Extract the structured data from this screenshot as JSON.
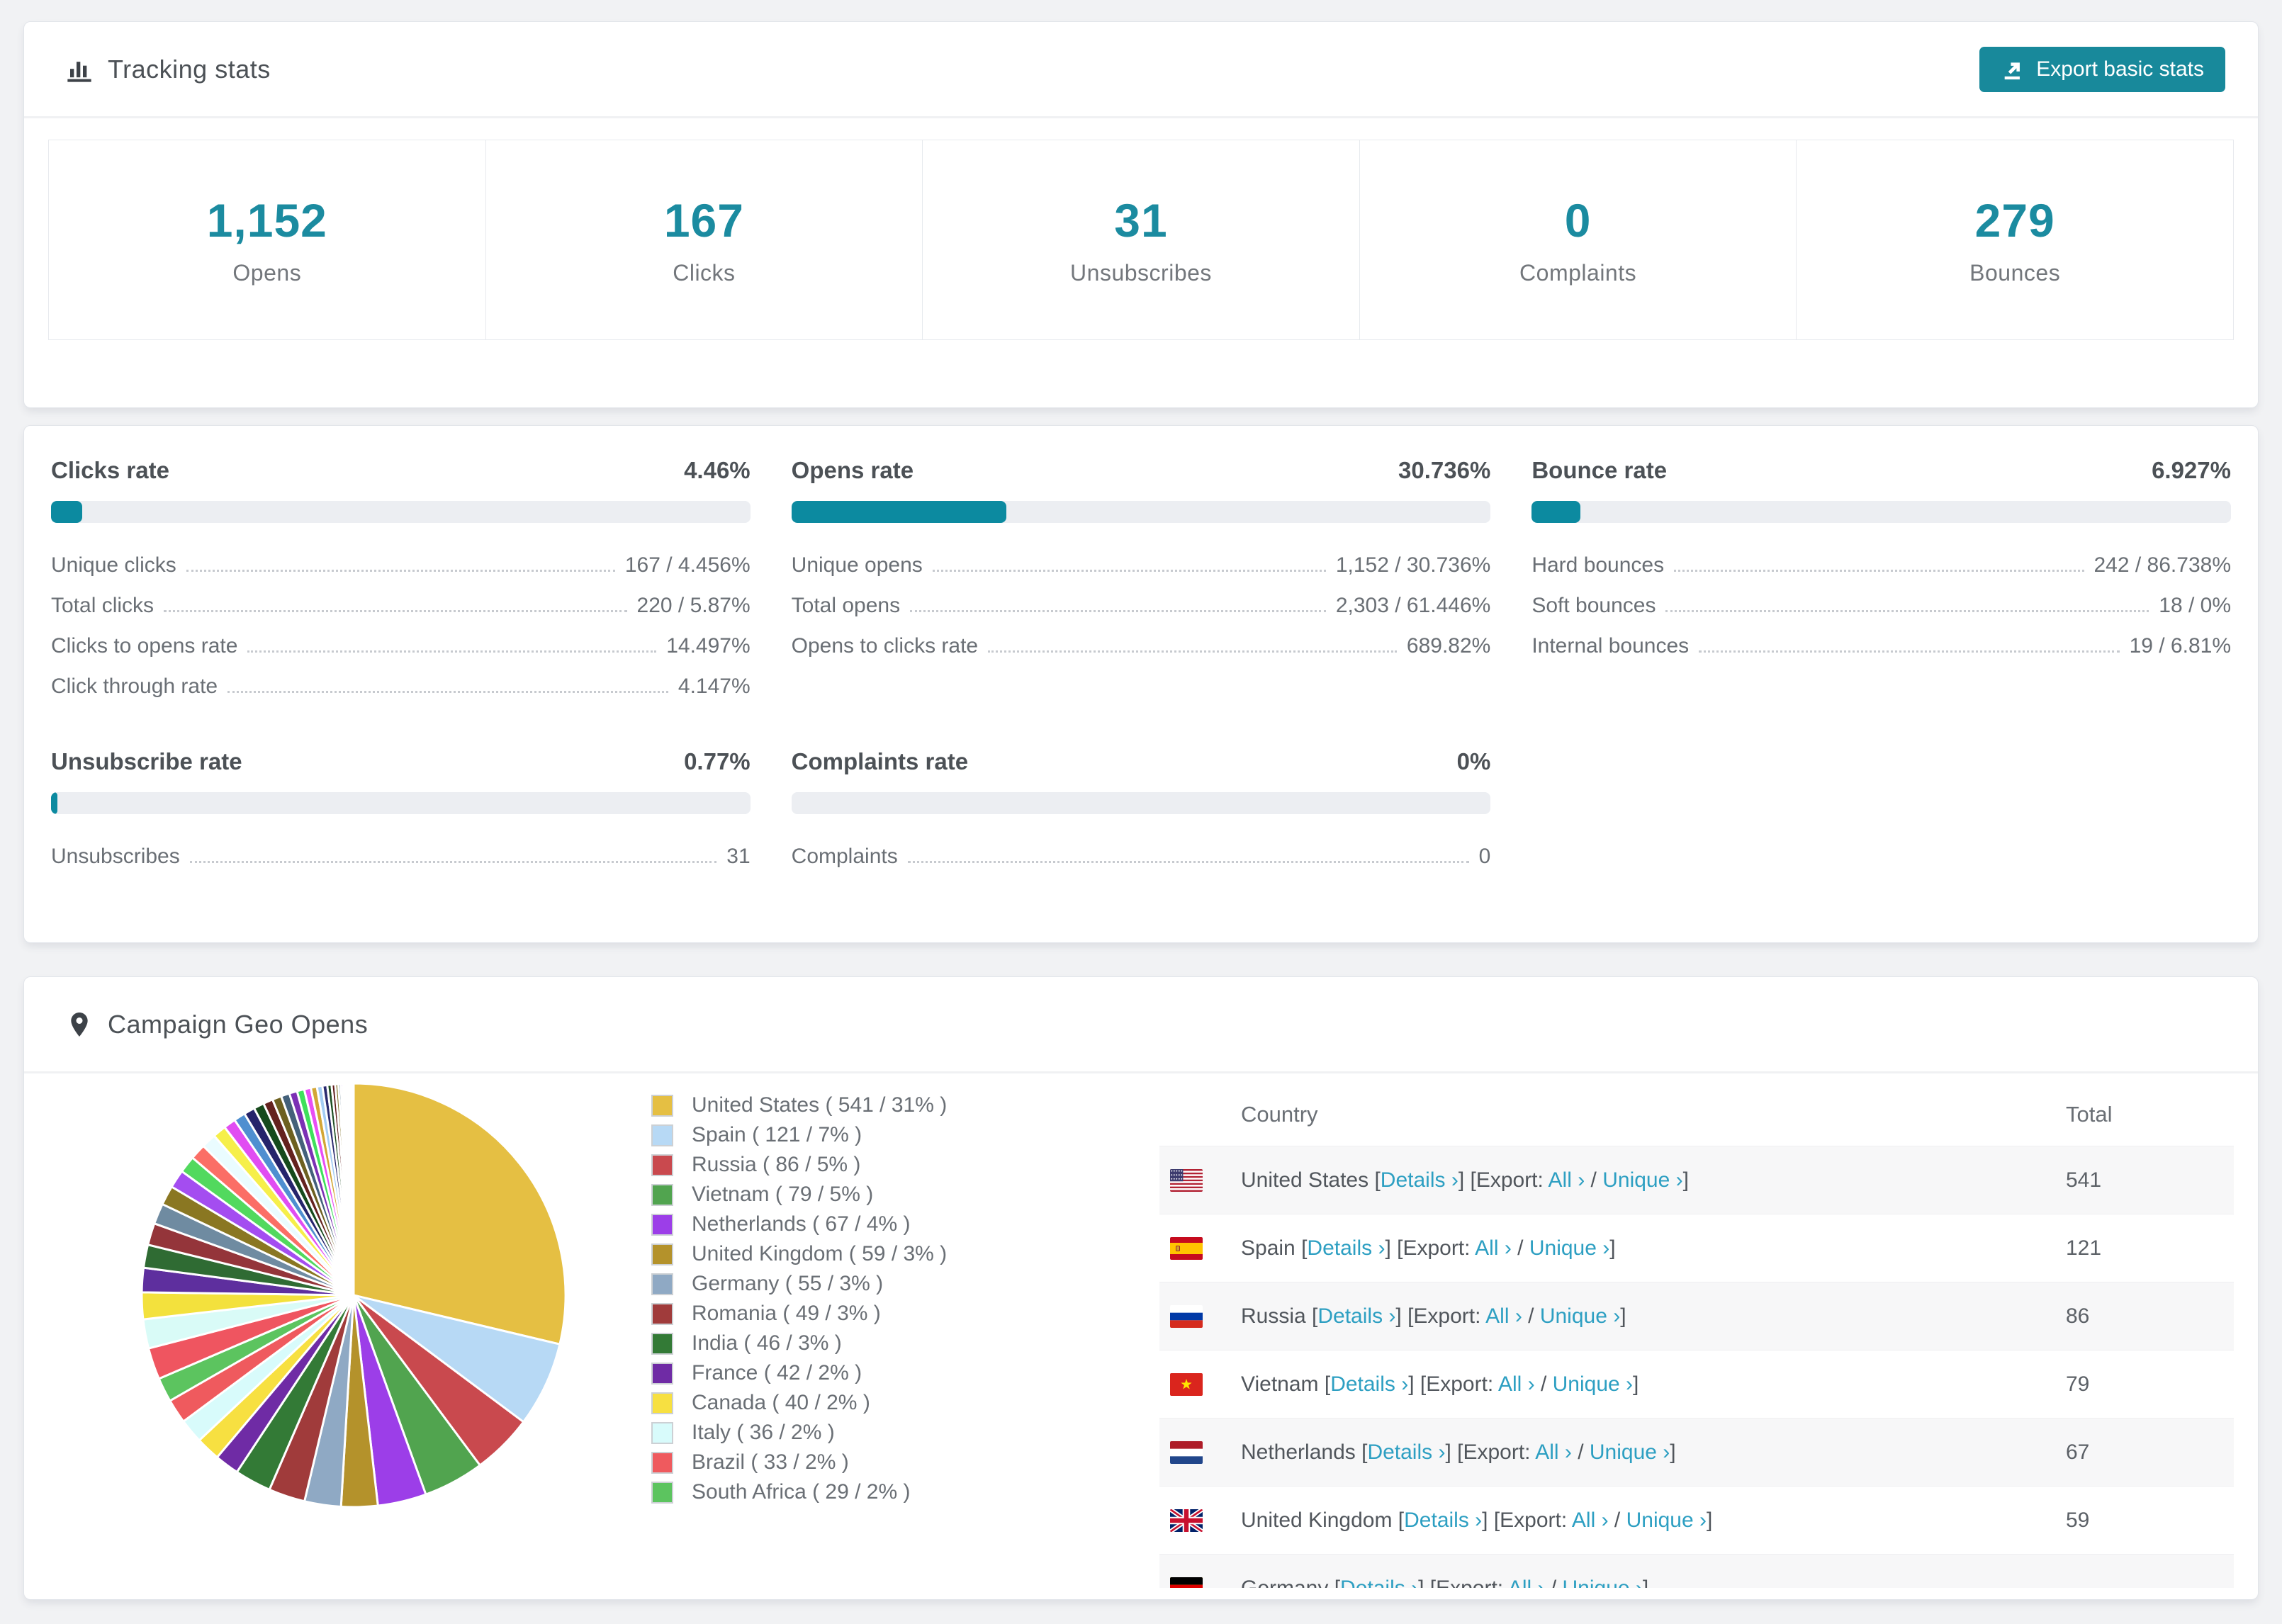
{
  "app": {
    "accent": "#18899b",
    "link_color": "#2d9fc2",
    "bar_fill": "#0c8aa0"
  },
  "tracking_card": {
    "title": "Tracking stats",
    "export_button_label": "Export basic stats",
    "stats": [
      {
        "value": "1,152",
        "label": "Opens"
      },
      {
        "value": "167",
        "label": "Clicks"
      },
      {
        "value": "31",
        "label": "Unsubscribes"
      },
      {
        "value": "0",
        "label": "Complaints"
      },
      {
        "value": "279",
        "label": "Bounces"
      }
    ]
  },
  "rates_card": {
    "blocks": [
      {
        "title": "Clicks rate",
        "value": "4.46%",
        "bar_pct": 4.46,
        "rows": [
          {
            "label": "Unique clicks",
            "value": "167 / 4.456%"
          },
          {
            "label": "Total clicks",
            "value": "220 / 5.87%"
          },
          {
            "label": "Clicks to opens rate",
            "value": "14.497%"
          },
          {
            "label": "Click through rate",
            "value": "4.147%"
          }
        ]
      },
      {
        "title": "Opens rate",
        "value": "30.736%",
        "bar_pct": 30.736,
        "rows": [
          {
            "label": "Unique opens",
            "value": "1,152 / 30.736%"
          },
          {
            "label": "Total opens",
            "value": "2,303 / 61.446%"
          },
          {
            "label": "Opens to clicks rate",
            "value": "689.82%"
          }
        ]
      },
      {
        "title": "Bounce rate",
        "value": "6.927%",
        "bar_pct": 6.927,
        "rows": [
          {
            "label": "Hard bounces",
            "value": "242 / 86.738%"
          },
          {
            "label": "Soft bounces",
            "value": "18 / 0%"
          },
          {
            "label": "Internal bounces",
            "value": "19 / 6.81%"
          }
        ]
      },
      {
        "title": "Unsubscribe rate",
        "value": "0.77%",
        "bar_pct": 0.77,
        "rows": [
          {
            "label": "Unsubscribes",
            "value": "31"
          }
        ]
      },
      {
        "title": "Complaints rate",
        "value": "0%",
        "bar_pct": 0,
        "rows": [
          {
            "label": "Complaints",
            "value": "0"
          }
        ]
      }
    ]
  },
  "geo_card": {
    "title": "Campaign Geo Opens",
    "table": {
      "headers": {
        "country": "Country",
        "total": "Total"
      },
      "link_labels": {
        "details": "Details ›",
        "export_prefix": "Export:",
        "all": "All ›",
        "unique": "Unique ›"
      },
      "rows": [
        {
          "flag": "us",
          "country": "United States",
          "total": "541"
        },
        {
          "flag": "es",
          "country": "Spain",
          "total": "121"
        },
        {
          "flag": "ru",
          "country": "Russia",
          "total": "86"
        },
        {
          "flag": "vn",
          "country": "Vietnam",
          "total": "79"
        },
        {
          "flag": "nl",
          "country": "Netherlands",
          "total": "67"
        },
        {
          "flag": "gb",
          "country": "United Kingdom",
          "total": "59"
        },
        {
          "flag": "de",
          "country": "Germany",
          "total": ""
        }
      ]
    },
    "chart_data": {
      "type": "pie",
      "title": "Campaign Geo Opens",
      "legend_position": "right-of-pie",
      "start_angle_deg": -90,
      "direction": "clockwise",
      "categories": [
        "United States",
        "Spain",
        "Russia",
        "Vietnam",
        "Netherlands",
        "United Kingdom",
        "Germany",
        "Romania",
        "India",
        "France",
        "Canada",
        "Italy",
        "Brazil",
        "South Africa"
      ],
      "values": [
        541,
        121,
        86,
        79,
        67,
        59,
        55,
        49,
        46,
        42,
        40,
        36,
        33,
        29
      ],
      "percents": [
        31,
        7,
        5,
        5,
        4,
        3,
        3,
        3,
        3,
        2,
        2,
        2,
        2,
        2
      ],
      "colors": [
        "#e5bf43",
        "#b7d9f5",
        "#c9494e",
        "#51a44f",
        "#9c3ee8",
        "#b4922b",
        "#8fa9c4",
        "#a03b3b",
        "#337a36",
        "#6f2ba5",
        "#f7e041",
        "#d8fbfb",
        "#ef5a5e",
        "#5cc45f"
      ],
      "other_slices": {
        "note": "long tail of smaller unlabeled countries",
        "values": [
          2.6,
          2.4,
          2.2,
          2.0,
          1.9,
          1.8,
          1.7,
          1.6,
          1.5,
          1.4,
          1.3,
          1.2,
          1.1,
          1.0,
          0.95,
          0.9,
          0.85,
          0.8,
          0.75,
          0.7,
          0.65,
          0.6,
          0.55,
          0.5,
          0.45,
          0.4,
          0.35,
          0.3,
          0.25,
          0.2,
          0.18,
          0.16,
          0.14,
          0.12,
          0.1,
          0.09,
          0.08,
          0.07,
          0.06,
          0.05
        ],
        "colors": [
          "#ef5560",
          "#d9fbf7",
          "#f3e13d",
          "#5e2f9e",
          "#2f6b33",
          "#94353a",
          "#6f8ba1",
          "#8a7722",
          "#a44df0",
          "#52d95e",
          "#fb6e66",
          "#eafcff",
          "#f6ef4a",
          "#e14df2",
          "#4f8fd0",
          "#26246b",
          "#164a1c",
          "#64221f",
          "#6d6020",
          "#44617a",
          "#7b31b4",
          "#3fe05c",
          "#e84ef5",
          "#d3a636",
          "#a5cdf3",
          "#2a2a6e",
          "#1d4d21",
          "#5e1a1a",
          "#7d6e22",
          "#4a6a82",
          "#8d3bf0",
          "#49e06a",
          "#f04fc0",
          "#c79a2f",
          "#92c4ef",
          "#23235f",
          "#174218",
          "#551818",
          "#6e611c",
          "#3e5a70"
        ]
      }
    }
  }
}
